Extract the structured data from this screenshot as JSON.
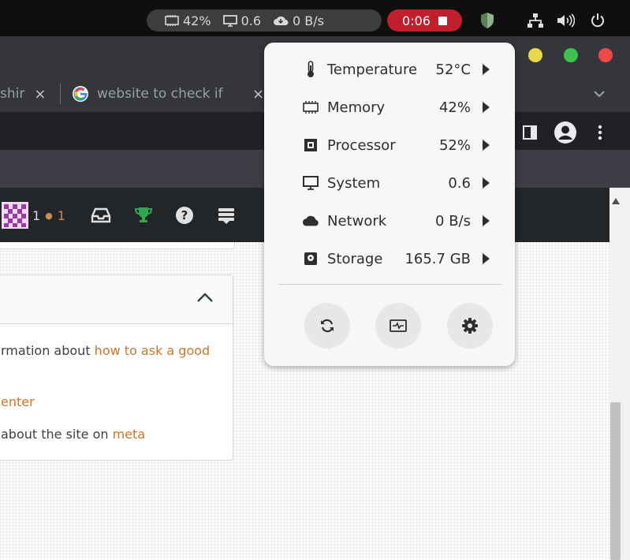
{
  "topbar": {
    "memory_stat": "42%",
    "system_stat": "0.6",
    "network_stat": "0 B/s",
    "recording_time": "0:06",
    "icons": [
      "memory-icon",
      "monitor-icon",
      "cloud-download-icon",
      "stop-icon",
      "shield-icon",
      "network-icon",
      "volume-icon",
      "power-icon"
    ]
  },
  "browser": {
    "tabs": [
      {
        "label": "shir",
        "close": "×"
      },
      {
        "label": "website to check if",
        "close": "×"
      }
    ],
    "window_button_colors": [
      "#e8d84a",
      "#3ec24e",
      "#e94b4b"
    ]
  },
  "site": {
    "reputation": "1",
    "bronze_badges": "1",
    "bronze_dot": "●"
  },
  "sidebar_card": {
    "line1_prefix": "rmation about ",
    "line1_link": "how to ask a good",
    "line2_link": "enter",
    "line3_prefix": "about the site on ",
    "line3_link": "meta"
  },
  "system_monitor": {
    "rows": [
      {
        "label": "Temperature",
        "value": "52°C",
        "icon": "thermometer-icon"
      },
      {
        "label": "Memory",
        "value": "42%",
        "icon": "memory-icon"
      },
      {
        "label": "Processor",
        "value": "52%",
        "icon": "processor-icon"
      },
      {
        "label": "System",
        "value": "0.6",
        "icon": "monitor-icon"
      },
      {
        "label": "Network",
        "value": "0 B/s",
        "icon": "cloud-icon"
      },
      {
        "label": "Storage",
        "value": "165.7 GB",
        "icon": "storage-icon"
      }
    ],
    "buttons": [
      "refresh-icon",
      "system-monitor-icon",
      "gear-icon"
    ]
  },
  "colors": {
    "recording": "#c0202e",
    "link": "#d0742a",
    "topbar": "#0f0f0f",
    "popup_bg": "#f7f7f7"
  }
}
